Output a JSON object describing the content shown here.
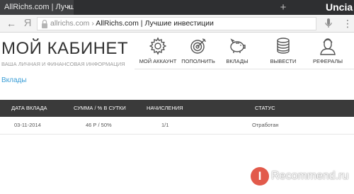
{
  "browser": {
    "tab_title": "AllRichs.com | Лучшие",
    "tab_close": "×",
    "new_tab": "+",
    "device_label": "Uncia",
    "back": "←",
    "brand_glyph": "Я",
    "url_domain": "allrichs.com",
    "url_separator": " › ",
    "url_title": "AllRichs.com | Лучшие инвестиции",
    "menu": "⋮"
  },
  "header": {
    "title": "МОЙ КАБИНЕТ",
    "subtitle": "ВАША ЛИЧНАЯ И ФИНАНСОВАЯ ИНФОРМАЦИЯ"
  },
  "nav": [
    {
      "label": "МОЙ АККАУНТ",
      "icon": "gear-icon"
    },
    {
      "label": "ПОПОЛНИТЬ",
      "icon": "target-icon"
    },
    {
      "label": "ВКЛАДЫ",
      "icon": "piggy-bank-icon"
    },
    {
      "label": "ВЫВЕСТИ",
      "icon": "coins-stack-icon"
    },
    {
      "label": "РЕФЕРАЛЫ",
      "icon": "user-icon"
    }
  ],
  "section": {
    "title": "Вклады"
  },
  "table": {
    "columns": [
      "ДАТА ВКЛАДА",
      "СУММА / % В СУТКИ",
      "НАЧИСЛЕНИЯ",
      "СТАТУС"
    ],
    "rows": [
      [
        "03-11-2014",
        "46 Р / 50%",
        "1/1",
        "Отработан"
      ]
    ]
  },
  "watermark": {
    "badge": "I",
    "text": "Recommend.ru"
  },
  "colors": {
    "link": "#3b9ed6",
    "table_header": "#3a3a3a",
    "tab_bar": "#2e2f31",
    "watermark_badge": "#e25a4b"
  }
}
